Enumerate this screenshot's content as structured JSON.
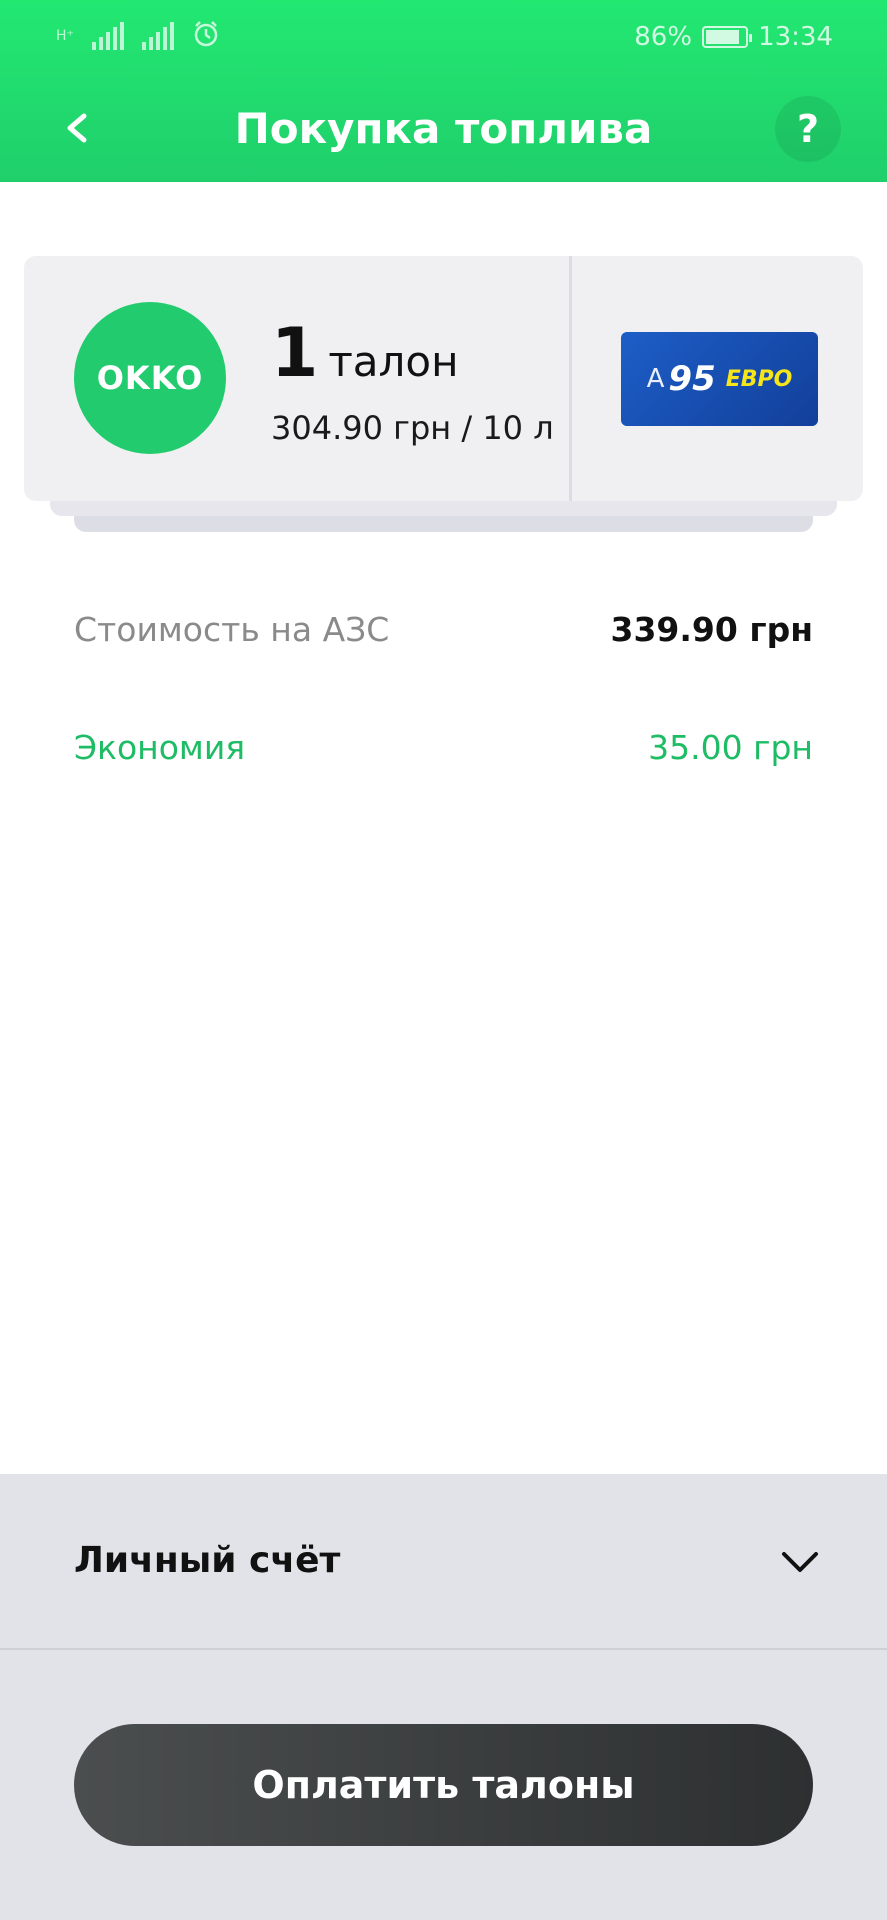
{
  "status_bar": {
    "network_type": "H⁺",
    "battery_percent": "86%",
    "battery_level": 0.86,
    "time": "13:34",
    "icons": [
      "signal-icon",
      "signal-icon",
      "alarm-icon",
      "battery-icon"
    ]
  },
  "header": {
    "title": "Покупка топлива",
    "back_icon": "chevron-left-icon",
    "help_label": "?",
    "background_color": "#22e872"
  },
  "ticket": {
    "brand_logo_text": "OKKO",
    "brand_color": "#22cc6e",
    "count": "1",
    "count_word": "талон",
    "price_per_volume": "304.90 грн / 10 л",
    "fuel": {
      "prefix": "A",
      "number": "95",
      "suffix": "ЕВРО"
    }
  },
  "summary": {
    "station_cost_label": "Стоимость на АЗС",
    "station_cost_value": "339.90 грн",
    "savings_label": "Экономия",
    "savings_value": "35.00 грн",
    "savings_color": "#1ebc64"
  },
  "payment": {
    "account_label": "Личный счёт",
    "account_icon": "chevron-down-icon",
    "pay_button_label": "Оплатить талоны"
  }
}
